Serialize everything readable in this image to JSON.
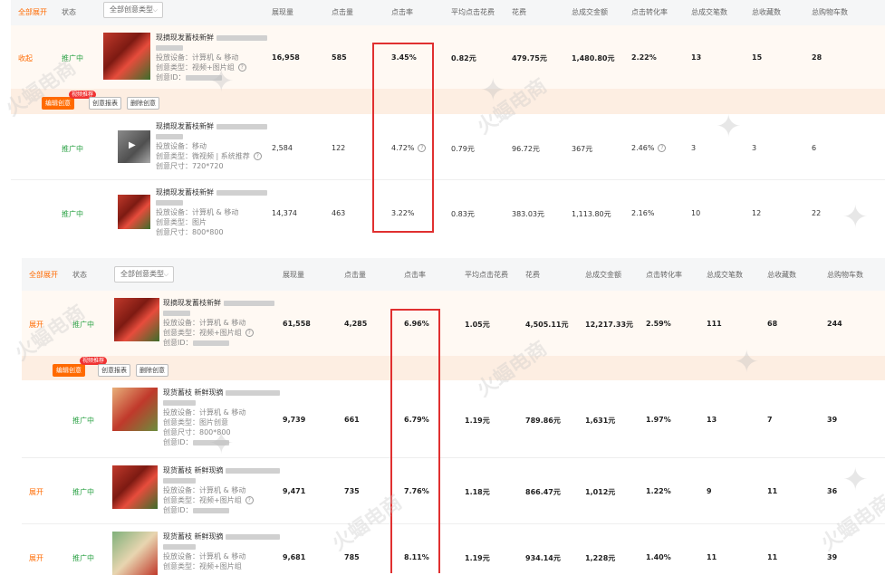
{
  "colors": {
    "accent": "#ff6a00",
    "status": "#2ba245",
    "highlight_box": "#e03030"
  },
  "top": {
    "header": {
      "expand_all": "全部展开",
      "status": "状态",
      "filter": "全部创意类型",
      "cols": [
        "展现量",
        "点击量",
        "点击率",
        "平均点击花费",
        "花费",
        "总成交金额",
        "点击转化率",
        "总成交笔数",
        "总收藏数",
        "总购物车数"
      ]
    },
    "rows": [
      {
        "toggle": "收起",
        "status": "推广中",
        "title": "现摘现发蓄枝新鲜",
        "device_label": "投放设备：",
        "device": "计算机 & 移动",
        "type_label": "创意类型：",
        "type": "视频+图片组",
        "id_label": "创意ID：",
        "vals": [
          "16,958",
          "585",
          "3.45%",
          "0.82元",
          "479.75元",
          "1,480.80元",
          "2.22%",
          "13",
          "15",
          "28"
        ]
      },
      {
        "toggle": "",
        "status": "推广中",
        "title": "现摘现发蓄枝新鲜",
        "device_label": "投放设备：",
        "device": "移动",
        "type_label": "创意类型：",
        "type": "微视频 | 系统推荐",
        "size_label": "创意尺寸：",
        "size": "720*720",
        "vals": [
          "2,584",
          "122",
          "4.72%",
          "0.79元",
          "96.72元",
          "367元",
          "2.46%",
          "3",
          "3",
          "6"
        ]
      },
      {
        "toggle": "",
        "status": "推广中",
        "title": "现摘现发蓄枝新鲜",
        "device_label": "投放设备：",
        "device": "计算机 & 移动",
        "type_label": "创意类型：",
        "type": "图片",
        "size_label": "创意尺寸：",
        "size": "800*800",
        "vals": [
          "14,374",
          "463",
          "3.22%",
          "0.83元",
          "383.03元",
          "1,113.80元",
          "2.16%",
          "10",
          "12",
          "22"
        ]
      }
    ],
    "actions": {
      "edit": "编辑创意",
      "badge": "视频推荐",
      "report": "创意报表",
      "delete": "删除创意"
    }
  },
  "bottom": {
    "header": {
      "expand_all": "全部展开",
      "status": "状态",
      "filter": "全部创意类型",
      "cols": [
        "展现量",
        "点击量",
        "点击率",
        "平均点击花费",
        "花费",
        "总成交金额",
        "点击转化率",
        "总成交笔数",
        "总收藏数",
        "总购物车数"
      ]
    },
    "rows": [
      {
        "toggle": "展开",
        "status": "推广中",
        "title": "现摘现发蓄枝新鲜",
        "device_label": "投放设备：",
        "device": "计算机 & 移动",
        "type_label": "创意类型：",
        "type": "视频+图片组",
        "id_label": "创意ID：",
        "vals": [
          "61,558",
          "4,285",
          "6.96%",
          "1.05元",
          "4,505.11元",
          "12,217.33元",
          "2.59%",
          "111",
          "68",
          "244"
        ]
      },
      {
        "toggle": "",
        "status": "推广中",
        "title": "现货蓄枝 新鲜现摘",
        "device_label": "投放设备：",
        "device": "计算机 & 移动",
        "type_label": "创意类型：",
        "type": "图片创意",
        "size_label": "创意尺寸：",
        "size": "800*800",
        "id_label": "创意ID：",
        "vals": [
          "9,739",
          "661",
          "6.79%",
          "1.19元",
          "789.86元",
          "1,631元",
          "1.97%",
          "13",
          "7",
          "39"
        ]
      },
      {
        "toggle": "展开",
        "status": "推广中",
        "title": "现货蓄枝 新鲜现摘",
        "device_label": "投放设备：",
        "device": "计算机 & 移动",
        "type_label": "创意类型：",
        "type": "视频+图片组",
        "id_label": "创意ID：",
        "vals": [
          "9,471",
          "735",
          "7.76%",
          "1.18元",
          "866.47元",
          "1,012元",
          "1.22%",
          "9",
          "11",
          "36"
        ]
      },
      {
        "toggle": "展开",
        "status": "推广中",
        "title": "现货蓄枝 新鲜现摘",
        "device_label": "投放设备：",
        "device": "计算机 & 移动",
        "type_label": "创意类型：",
        "type": "视频+图片组",
        "vals": [
          "9,681",
          "785",
          "8.11%",
          "1.19元",
          "934.14元",
          "1,228元",
          "1.40%",
          "11",
          "11",
          "39"
        ]
      }
    ],
    "actions": {
      "edit": "编辑创意",
      "badge": "视频推荐",
      "report": "创意报表",
      "delete": "删除创意"
    }
  },
  "watermark": "火蝠电商"
}
